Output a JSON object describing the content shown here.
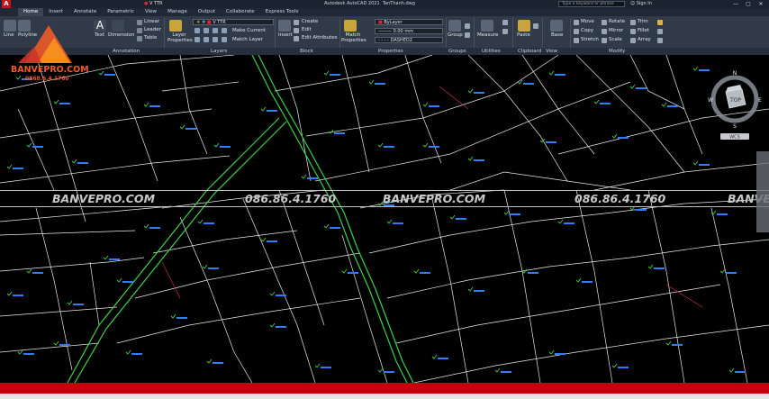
{
  "app": {
    "title": "Autodesk AutoCAD 2021",
    "filename": "TanThanh.dwg",
    "search_placeholder": "Type a keyword or phrase",
    "sign_in": "Sign In",
    "quick_layer": "V TTR",
    "window_buttons": [
      "—",
      "▢",
      "✕"
    ]
  },
  "tabs": [
    "Home",
    "Insert",
    "Annotate",
    "Parametric",
    "View",
    "Manage",
    "Output",
    "Collaborate",
    "Express Tools"
  ],
  "ribbon": {
    "draw": [
      "Line",
      "Polyline"
    ],
    "annotation": {
      "text": "Text",
      "dimension": "Dimension",
      "linear": "Linear",
      "leader": "Leader",
      "table": "Table"
    },
    "layers": {
      "layer_properties": "Layer Properties",
      "current_layer": "V TTR",
      "make_current": "Make Current",
      "match_layer": "Match Layer"
    },
    "block": {
      "insert": "Insert",
      "create": "Create",
      "edit": "Edit",
      "edit_attributes": "Edit Attributes"
    },
    "properties": {
      "match": "Match Properties",
      "color": "ByLayer",
      "lineweight": "0.00 mm",
      "linetype": "DASHED2"
    },
    "groups": {
      "group": "Group"
    },
    "utilities": {
      "measure": "Measure"
    },
    "clipboard": {
      "paste": "Paste"
    },
    "view": {
      "base": "Base"
    },
    "modify": [
      "Move",
      "Rotate",
      "Trim",
      "Copy",
      "Mirror",
      "Fillet",
      "Stretch",
      "Scale",
      "Array"
    ]
  },
  "panels": [
    "Annotation",
    "Layers",
    "Block",
    "Properties",
    "Groups",
    "Utilities",
    "Clipboard",
    "View",
    "Modify"
  ],
  "branding": {
    "name": "BANVEPRO.COM",
    "phone": "0868.6.4.1760"
  },
  "watermark": {
    "site": "BANVEPRO.COM",
    "phone": "086.86.4.1760"
  },
  "compass": {
    "north": "N",
    "south": "S",
    "west": "W",
    "east": "E",
    "top": "TOP",
    "wcs": "WCS"
  },
  "colors": {
    "ribbon": "#303a48",
    "canvas": "#000000",
    "status_bar": "#c4000e",
    "brand": "#f05a28",
    "road": "#39d34a",
    "parcel_line": "#ffffff"
  }
}
